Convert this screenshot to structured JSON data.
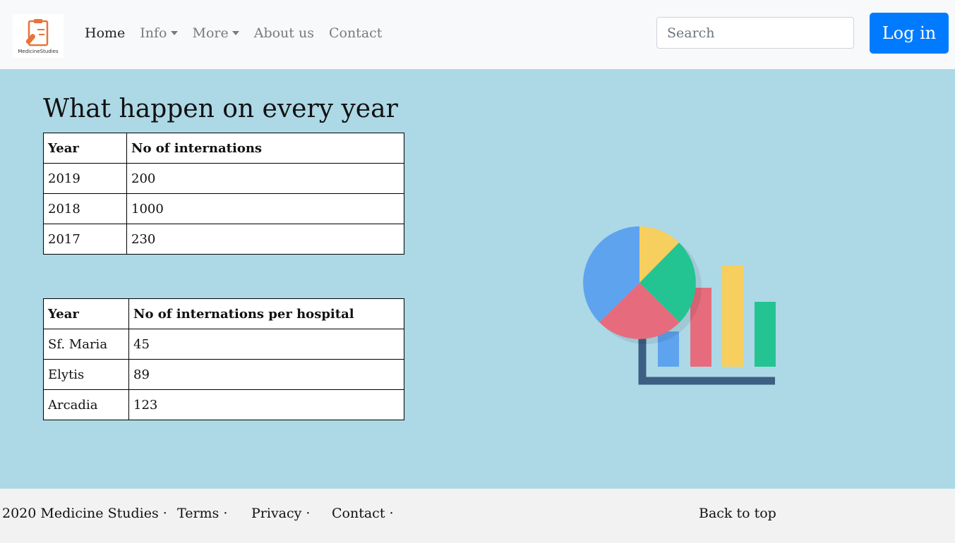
{
  "logo": {
    "caption": "MedicineStudies"
  },
  "nav": {
    "items": [
      {
        "label": "Home",
        "active": true,
        "dropdown": false
      },
      {
        "label": "Info",
        "active": false,
        "dropdown": true
      },
      {
        "label": "More",
        "active": false,
        "dropdown": true
      },
      {
        "label": "About us",
        "active": false,
        "dropdown": false
      },
      {
        "label": "Contact",
        "active": false,
        "dropdown": false
      }
    ],
    "search_placeholder": "Search",
    "login_label": "Log in"
  },
  "main": {
    "heading": "What happen on every year",
    "table1": {
      "headers": [
        "Year",
        "No of internations"
      ],
      "rows": [
        [
          "2019",
          "200"
        ],
        [
          "2018",
          "1000"
        ],
        [
          "2017",
          "230"
        ]
      ]
    },
    "table2": {
      "headers": [
        "Year",
        "No of internations per hospital"
      ],
      "rows": [
        [
          "Sf. Maria",
          "45"
        ],
        [
          "Elytis",
          "89"
        ],
        [
          "Arcadia",
          "123"
        ]
      ]
    }
  },
  "footer": {
    "copyright": "2020 Medicine Studies ·",
    "terms": "Terms ·",
    "privacy": "Privacy ·",
    "contact": "Contact ·",
    "back_to_top": "Back to top"
  },
  "colors": {
    "nav_bg": "#f8f9fa",
    "main_bg": "#add8e6",
    "primary": "#007bff",
    "footer_bg": "#f2f2f2"
  }
}
